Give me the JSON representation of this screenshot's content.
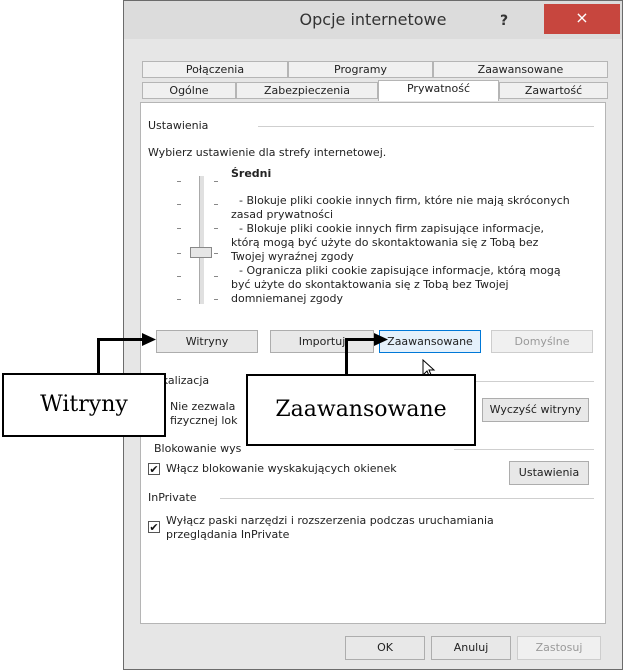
{
  "window": {
    "title": "Opcje internetowe",
    "help": "?",
    "close": "×"
  },
  "tabs": {
    "row1": [
      "Połączenia",
      "Programy",
      "Zaawansowane"
    ],
    "row2": [
      "Ogólne",
      "Zabezpieczenia",
      "Prywatność",
      "Zawartość"
    ],
    "active": "Prywatność"
  },
  "settings": {
    "group": "Ustawienia",
    "instruction": "Wybierz ustawienie dla strefy internetowej.",
    "level": "Średni",
    "desc_lines": [
      "- Blokuje pliki cookie innych firm, które nie mają skróconych",
      "zasad prywatności",
      "- Blokuje pliki cookie innych firm zapisujące informacje,",
      "którą mogą być użyte do skontaktowania się z Tobą bez",
      "Twojej wyraźnej zgody",
      "- Ogranicza pliki cookie zapisujące informacje, którą mogą",
      "być użyte do skontaktowania się z Tobą bez Twojej",
      "domniemanej zgody"
    ],
    "buttons": {
      "sites": "Witryny",
      "import": "Importuj",
      "advanced": "Zaawansowane",
      "default": "Domyślne"
    }
  },
  "location": {
    "group": "okalizacja",
    "checkbox_line1": "Nie zezwala",
    "checkbox_line2": "fizycznej lok",
    "clear_button": "Wyczyść witryny"
  },
  "popup": {
    "group": "Blokowanie wys",
    "checkbox_label": "Włącz blokowanie wyskakujących okienek",
    "checked": true,
    "settings_button": "Ustawienia"
  },
  "inprivate": {
    "group": "InPrivate",
    "checkbox_line1": "Wyłącz paski narzędzi i rozszerzenia podczas uruchamiania",
    "checkbox_line2": "przeglądania InPrivate",
    "checked": true
  },
  "footer": {
    "ok": "OK",
    "cancel": "Anuluj",
    "apply": "Zastosuj"
  },
  "callouts": {
    "sites": "Witryny",
    "advanced": "Zaawansowane"
  },
  "check_glyph": "✔"
}
